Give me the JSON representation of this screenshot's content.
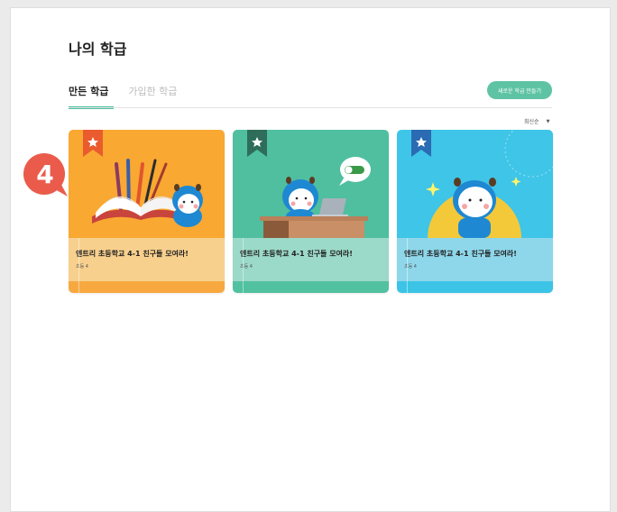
{
  "page": {
    "title": "나의 학급",
    "tabs": [
      {
        "label": "만든 학급",
        "active": true
      },
      {
        "label": "가입한 학급",
        "active": false
      }
    ],
    "create_button": "새로운 학급 만들기",
    "sort_label": "최신순"
  },
  "step_badge": {
    "number": "4",
    "color": "#ea5b4b"
  },
  "classes": [
    {
      "title": "엔트리 초등학교 4-1 친구들 모여라!",
      "grade": "초등 4",
      "theme": "orange",
      "art_color": "#f9a832",
      "info_color": "#f8d08d",
      "foot_color": "#f7a940"
    },
    {
      "title": "엔트리 초등학교 4-1 친구들 모여라!",
      "grade": "초등 4",
      "theme": "green",
      "art_color": "#4fbf9f",
      "info_color": "#9bd9c8",
      "foot_color": "#52c1a0"
    },
    {
      "title": "엔트리 초등학교 4-1 친구들 모여라!",
      "grade": "초등 4",
      "theme": "blue",
      "art_color": "#3ec5e8",
      "info_color": "#8ed7ea",
      "foot_color": "#3cc4e6"
    }
  ]
}
